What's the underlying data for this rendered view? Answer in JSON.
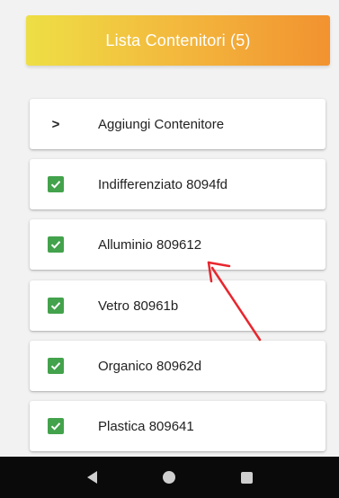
{
  "header": {
    "title": "Lista Contenitori (5)"
  },
  "add_item": {
    "label": "Aggiungi Contenitore",
    "icon": "chevron-right-icon"
  },
  "containers": [
    {
      "label": "Indifferenziato 8094fd",
      "checked": true
    },
    {
      "label": "Alluminio 809612",
      "checked": true
    },
    {
      "label": "Vetro 80961b",
      "checked": true
    },
    {
      "label": "Organico 80962d",
      "checked": true
    },
    {
      "label": "Plastica 809641",
      "checked": true
    }
  ],
  "colors": {
    "header_gradient_start": "#eedf45",
    "header_gradient_end": "#f29230",
    "checkbox": "#43a24c",
    "annotation_arrow": "#e8262e",
    "nav_bar": "#0a0a0a"
  },
  "nav": {
    "back_icon": "back-triangle-icon",
    "home_icon": "home-circle-icon",
    "recents_icon": "recents-square-icon"
  }
}
